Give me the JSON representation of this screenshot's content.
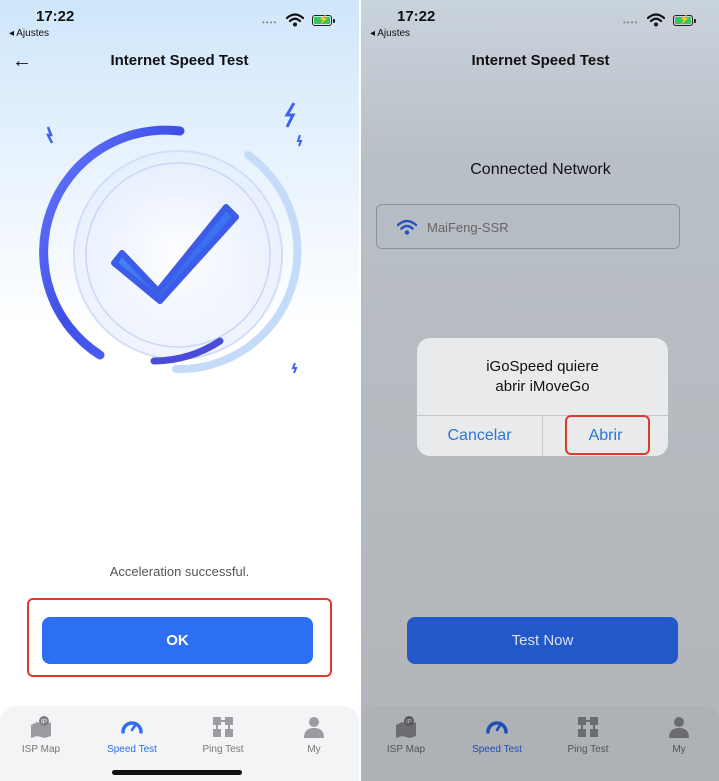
{
  "status_bar": {
    "time": "17:22",
    "back_app": "◂ Ajustes",
    "signal": "••••"
  },
  "left_screen": {
    "header_title": "Internet Speed Test",
    "success_text": "Acceleration successful.",
    "ok_label": "OK"
  },
  "right_screen": {
    "header_title": "Internet Speed Test",
    "connected_title": "Connected Network",
    "network_name": "MaiFeng-SSR",
    "alert": {
      "message_line1": "iGoSpeed quiere",
      "message_line2": "abrir iMoveGo",
      "cancel": "Cancelar",
      "open": "Abrir"
    },
    "test_now": "Test Now"
  },
  "tabs": [
    {
      "label": "ISP Map",
      "icon": "isp-map-icon"
    },
    {
      "label": "Speed Test",
      "icon": "speedometer-icon"
    },
    {
      "label": "Ping Test",
      "icon": "ping-grid-icon"
    },
    {
      "label": "My",
      "icon": "person-icon"
    }
  ],
  "colors": {
    "accent": "#2d6ff3",
    "highlight": "#e03a2f",
    "alert_link": "#2a76d8"
  }
}
